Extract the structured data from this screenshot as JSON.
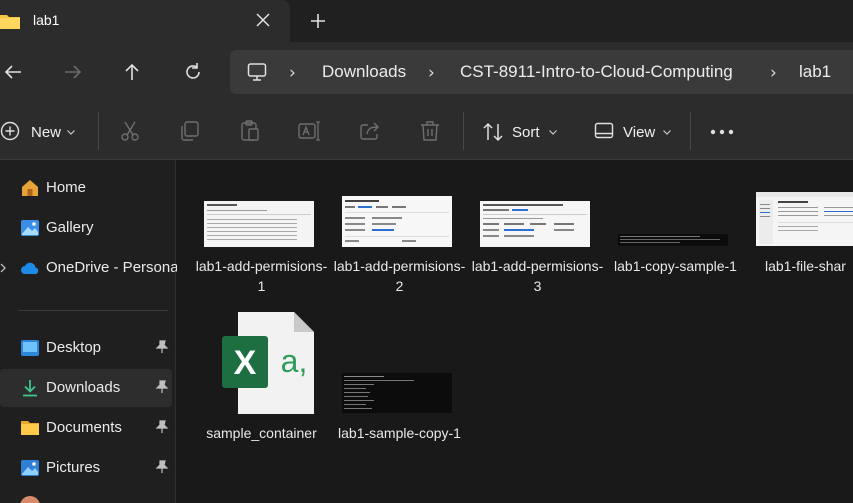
{
  "tab": {
    "title": "lab1"
  },
  "breadcrumb": [
    "Downloads",
    "CST-8911-Intro-to-Cloud-Computing",
    "lab1"
  ],
  "commands": {
    "new_label": "New",
    "sort_label": "Sort",
    "view_label": "View"
  },
  "sidebar": {
    "items": [
      {
        "label": "Home"
      },
      {
        "label": "Gallery"
      },
      {
        "label": "OneDrive - Persona"
      },
      {
        "label": "Desktop"
      },
      {
        "label": "Downloads"
      },
      {
        "label": "Documents"
      },
      {
        "label": "Pictures"
      }
    ]
  },
  "files": [
    {
      "name": "lab1-add-permisions-1",
      "kind": "screenshot-light"
    },
    {
      "name": "lab1-add-permisions-2",
      "kind": "screenshot-light"
    },
    {
      "name": "lab1-add-permisions-3",
      "kind": "screenshot-light"
    },
    {
      "name": "lab1-copy-sample-1",
      "kind": "screenshot-dark"
    },
    {
      "name": "lab1-file-shar",
      "kind": "screenshot-light"
    },
    {
      "name": "sample_container",
      "kind": "excel-csv-icon"
    },
    {
      "name": "lab1-sample-copy-1",
      "kind": "screenshot-dark"
    }
  ],
  "colors": {
    "folder": "#f5c542",
    "accent": "#4cc2ff",
    "excel_green": "#1d6f42"
  }
}
